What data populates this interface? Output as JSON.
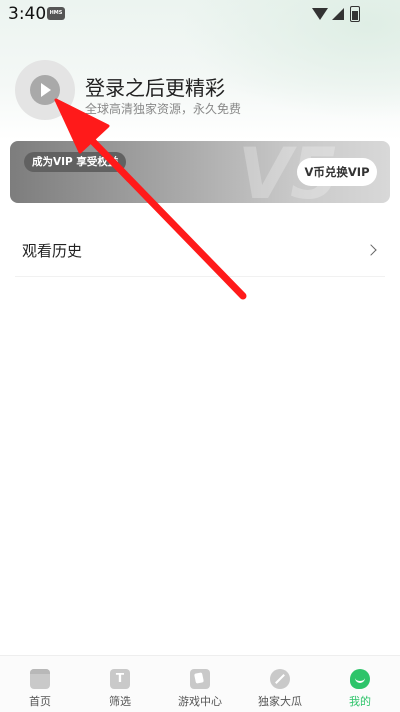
{
  "status_bar": {
    "time": "3:40",
    "badge": "HMS"
  },
  "profile": {
    "title": "登录之后更精彩",
    "subtitle": "全球高清独家资源，永久免费",
    "avatar_icon": "play-circle-icon"
  },
  "vip_banner": {
    "promo_label": "成为VIP 享受权益",
    "exchange_button": "V币兑换VIP",
    "watermark": "V5"
  },
  "menu": {
    "history_label": "观看历史"
  },
  "annotation": {
    "arrow_color": "#ff1a1a"
  },
  "bottom_nav": {
    "items": [
      {
        "label": "首页",
        "icon": "clapperboard-icon"
      },
      {
        "label": "筛选",
        "icon": "filter-icon"
      },
      {
        "label": "游戏中心",
        "icon": "game-cards-icon"
      },
      {
        "label": "独家大瓜",
        "icon": "melon-icon"
      },
      {
        "label": "我的",
        "icon": "mine-icon",
        "active": true
      }
    ],
    "active_color": "#2ec46a"
  }
}
